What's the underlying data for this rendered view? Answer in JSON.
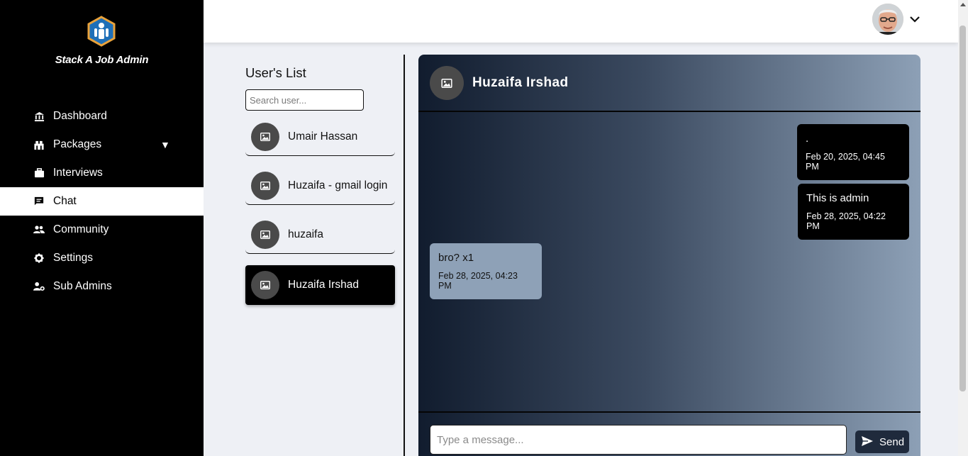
{
  "app": {
    "brand_name": "Stack A Job Admin"
  },
  "sidebar": {
    "items": [
      {
        "label": "Dashboard",
        "icon": "bank-icon"
      },
      {
        "label": "Packages",
        "icon": "packages-icon",
        "has_caret": true
      },
      {
        "label": "Interviews",
        "icon": "briefcase-icon"
      },
      {
        "label": "Chat",
        "icon": "chat-icon",
        "active": true
      },
      {
        "label": "Community",
        "icon": "users-icon"
      },
      {
        "label": "Settings",
        "icon": "gear-icon"
      },
      {
        "label": "Sub Admins",
        "icon": "user-gear-icon"
      }
    ]
  },
  "header": {
    "avatar_icon": "user-avatar",
    "menu_icon": "chevron-down-icon"
  },
  "users_panel": {
    "title": "User's List",
    "search_placeholder": "Search user...",
    "users": [
      {
        "name": "Umair Hassan",
        "selected": false
      },
      {
        "name": "Huzaifa - gmail login",
        "selected": false
      },
      {
        "name": "huzaifa",
        "selected": false
      },
      {
        "name": "Huzaifa Irshad",
        "selected": true
      }
    ]
  },
  "chat": {
    "contact_name": "Huzaifa Irshad",
    "messages": [
      {
        "direction": "out",
        "text": ".",
        "time": "Feb 20, 2025, 04:45 PM"
      },
      {
        "direction": "out",
        "text": "This is admin",
        "time": "Feb 28, 2025, 04:22 PM"
      },
      {
        "direction": "in",
        "text": "bro? x1",
        "time": "Feb 28, 2025, 04:23 PM"
      }
    ],
    "input_placeholder": "Type a message...",
    "send_label": "Send"
  },
  "colors": {
    "sidebar_bg": "#000000",
    "accent_logo": "#1e6fb8",
    "chat_gradient_start": "#111c2e",
    "chat_gradient_end": "#8da0b6",
    "incoming_bubble": "#8ea1b7",
    "outgoing_bubble": "#000000"
  }
}
